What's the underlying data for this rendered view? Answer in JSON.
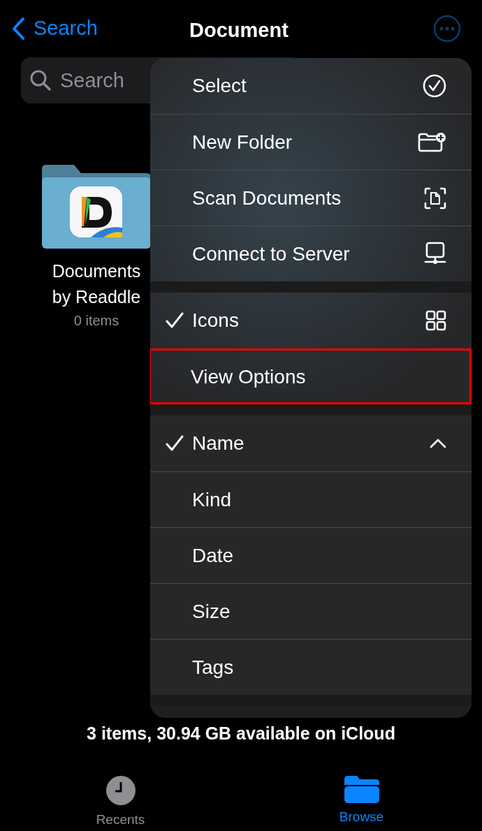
{
  "nav": {
    "back_label": "Search",
    "title": "Document"
  },
  "search": {
    "placeholder": "Search"
  },
  "folder": {
    "name": "Documents by Readdle",
    "count": "0 items"
  },
  "menu": {
    "sections": [
      {
        "items": [
          {
            "label": "Select"
          },
          {
            "label": "New Folder"
          },
          {
            "label": "Scan Documents"
          },
          {
            "label": "Connect to Server"
          }
        ]
      },
      {
        "items": [
          {
            "label": "Icons",
            "checked": true,
            "highlighted": false
          },
          {
            "label": "View Options",
            "checked": false,
            "highlighted": true
          }
        ]
      },
      {
        "items": [
          {
            "label": "Name",
            "checked": true
          },
          {
            "label": "Kind",
            "checked": false
          },
          {
            "label": "Date",
            "checked": false
          },
          {
            "label": "Size",
            "checked": false
          },
          {
            "label": "Tags",
            "checked": false
          }
        ]
      }
    ]
  },
  "status": "3 items, 30.94 GB available on iCloud",
  "tabs": [
    {
      "label": "Recents",
      "selected": false
    },
    {
      "label": "Browse",
      "selected": true
    }
  ]
}
